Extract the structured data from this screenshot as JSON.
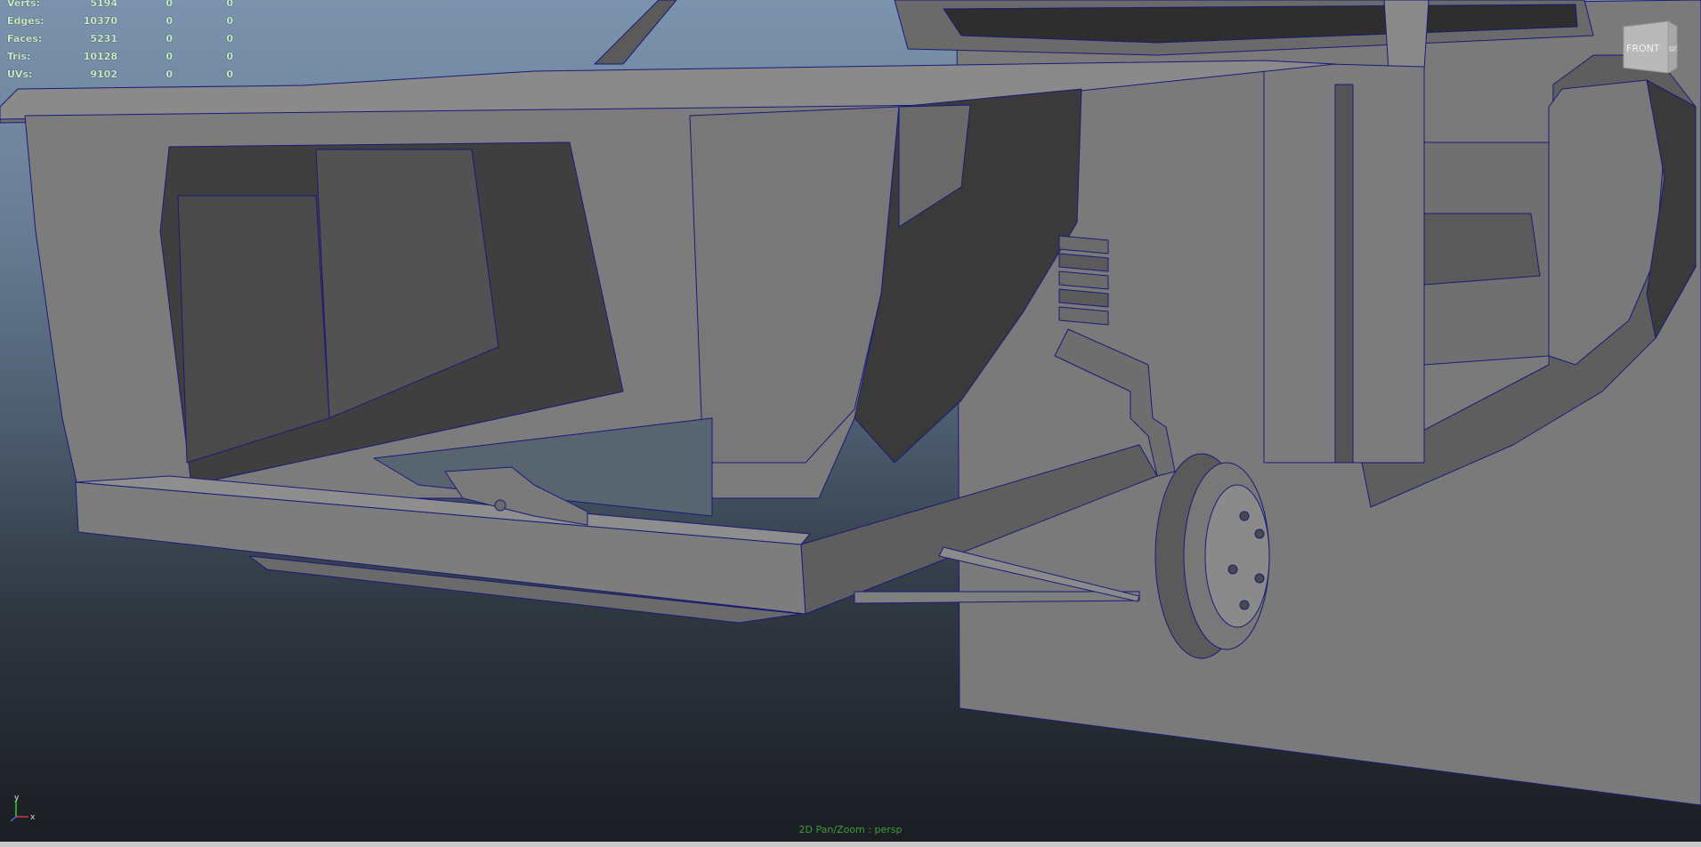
{
  "hud": {
    "rows": [
      {
        "label": "Verts:",
        "total": "5194",
        "selected": "0",
        "component": "0"
      },
      {
        "label": "Edges:",
        "total": "10370",
        "selected": "0",
        "component": "0"
      },
      {
        "label": "Faces:",
        "total": "5231",
        "selected": "0",
        "component": "0"
      },
      {
        "label": "Tris:",
        "total": "10128",
        "selected": "0",
        "component": "0"
      },
      {
        "label": "UVs:",
        "total": "9102",
        "selected": "0",
        "component": "0"
      }
    ]
  },
  "viewcube": {
    "front": "FRONT",
    "right": "RIGHT"
  },
  "axis": {
    "x": "x",
    "y": "y"
  },
  "status": {
    "text": "2D Pan/Zoom : persp"
  },
  "colors": {
    "wire": "#1a1a7a",
    "hud_text": "#c9eac9",
    "status_text": "#3c9c3c",
    "panel_mid": "#7b7b7b",
    "panel_dark": "#3c3c3c"
  }
}
